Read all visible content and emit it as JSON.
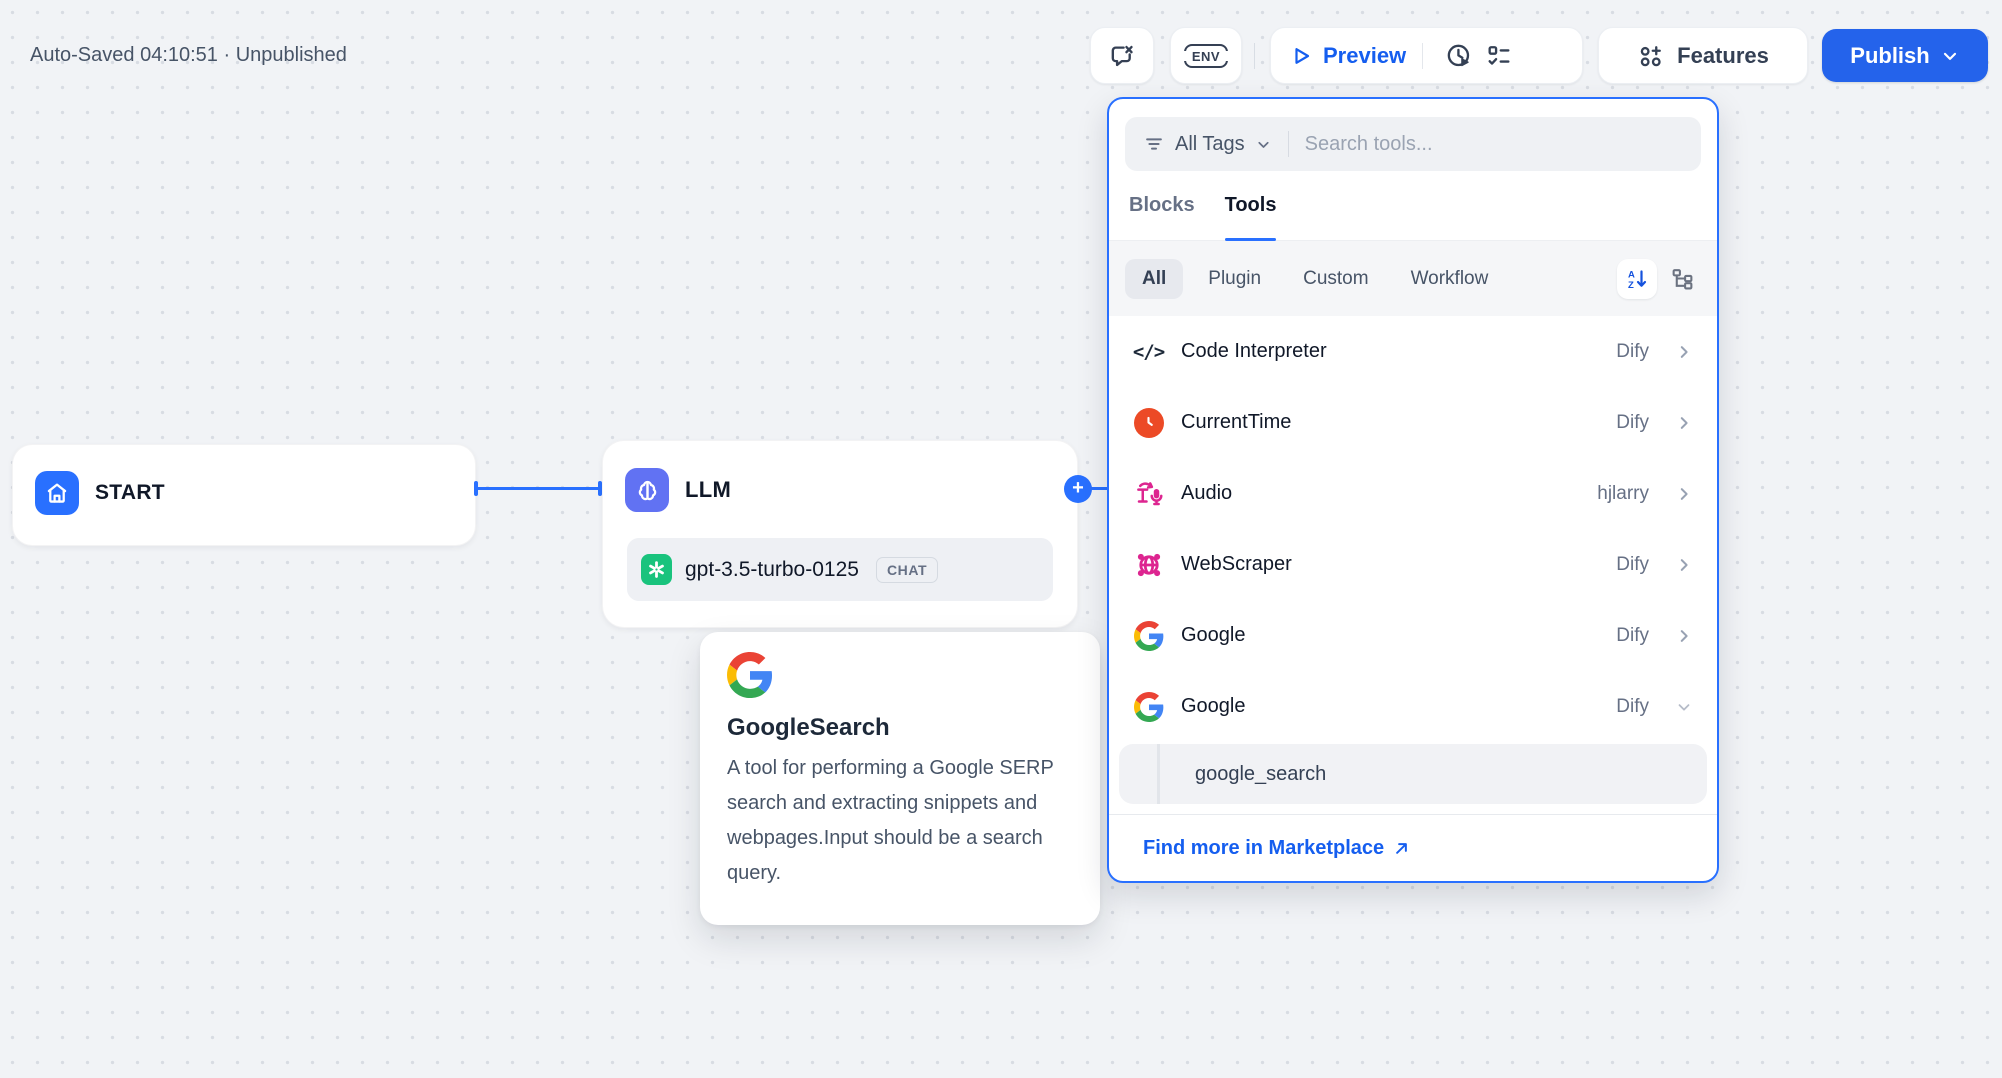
{
  "header": {
    "autosave_status": "Auto-Saved 04:10:51 · Unpublished",
    "env_label": "ENV",
    "preview_label": "Preview",
    "features_label": "Features",
    "publish_label": "Publish"
  },
  "canvas": {
    "start_node": {
      "title": "START",
      "icon": "home-icon"
    },
    "llm_node": {
      "title": "LLM",
      "icon": "brain-icon",
      "model_name": "gpt-3.5-turbo-0125",
      "model_icon": "openai-icon",
      "mode_badge": "CHAT"
    },
    "tooltip_card": {
      "icon": "google-logo-icon",
      "title": "GoogleSearch",
      "description": "A tool for performing a Google SERP search and extracting snippets and webpages.Input should be a search query."
    }
  },
  "panel": {
    "tags_filter_label": "All Tags",
    "search_placeholder": "Search tools...",
    "tabs": [
      {
        "label": "Blocks",
        "active": false
      },
      {
        "label": "Tools",
        "active": true
      }
    ],
    "subtabs": [
      {
        "label": "All",
        "active": true
      },
      {
        "label": "Plugin",
        "active": false
      },
      {
        "label": "Custom",
        "active": false
      },
      {
        "label": "Workflow",
        "active": false
      }
    ],
    "tools": [
      {
        "name": "Code Interpreter",
        "provider": "Dify",
        "icon": "code-interpreter-icon",
        "expanded": false
      },
      {
        "name": "CurrentTime",
        "provider": "Dify",
        "icon": "clock-icon",
        "expanded": false
      },
      {
        "name": "Audio",
        "provider": "hjlarry",
        "icon": "audio-icon",
        "expanded": false
      },
      {
        "name": "WebScraper",
        "provider": "Dify",
        "icon": "webscraper-icon",
        "expanded": false
      },
      {
        "name": "Google",
        "provider": "Dify",
        "icon": "google-logo-icon",
        "expanded": false
      },
      {
        "name": "Google",
        "provider": "Dify",
        "icon": "google-logo-icon",
        "expanded": true
      }
    ],
    "expanded_subtool": "google_search",
    "footer_link_label": "Find more in Marketplace"
  },
  "colors": {
    "accent_blue": "#2970ff",
    "link_blue": "#155eef",
    "publish_blue": "#2463eb",
    "llm_indigo": "#6172f3",
    "openai_green": "#19c37d",
    "clock_orange": "#ec4a26",
    "pink_magenta": "#dd2590"
  }
}
